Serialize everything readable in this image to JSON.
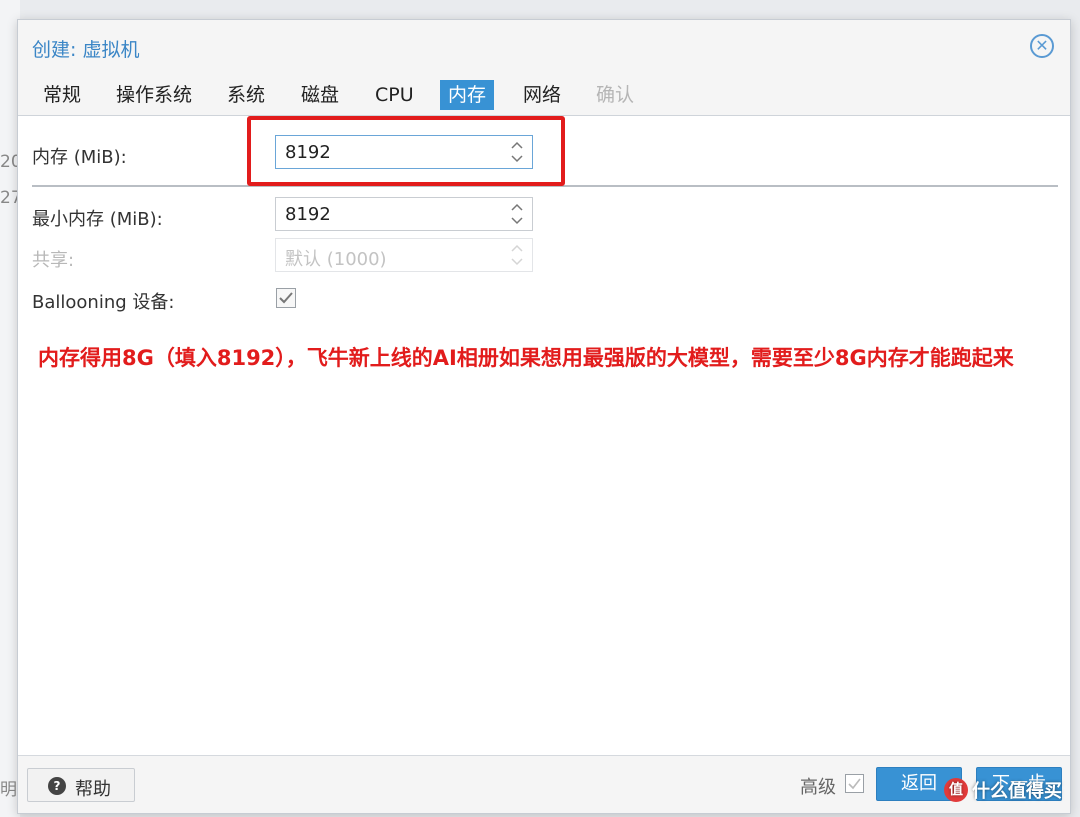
{
  "background": {
    "peek_1": "20",
    "peek_2": "27",
    "peek_3": "明"
  },
  "dialog": {
    "title": "创建: 虚拟机",
    "close_icon": "close-circle-icon"
  },
  "tabs": [
    {
      "label": "常规",
      "state": "normal"
    },
    {
      "label": "操作系统",
      "state": "normal"
    },
    {
      "label": "系统",
      "state": "normal"
    },
    {
      "label": "磁盘",
      "state": "normal"
    },
    {
      "label": "CPU",
      "state": "normal"
    },
    {
      "label": "内存",
      "state": "active"
    },
    {
      "label": "网络",
      "state": "normal"
    },
    {
      "label": "确认",
      "state": "disabled"
    }
  ],
  "form": {
    "memory": {
      "label": "内存 (MiB):",
      "value": "8192"
    },
    "min_memory": {
      "label": "最小内存 (MiB):",
      "value": "8192"
    },
    "shares": {
      "label": "共享:",
      "placeholder": "默认 (1000)"
    },
    "ballooning": {
      "label": "Ballooning 设备:",
      "checked": true
    }
  },
  "annotation": {
    "text": "内存得用8G（填入8192），飞牛新上线的AI相册如果想用最强版的大模型，需要至少8G内存才能跑起来",
    "color": "#e21c1c"
  },
  "footer": {
    "help_label": "帮助",
    "advanced_label": "高级",
    "advanced_checked": false,
    "back_label": "返回",
    "next_label": "下一步"
  },
  "watermark": {
    "text": "什么值得买",
    "icon": "值"
  },
  "colors": {
    "accent": "#3892d4",
    "title": "#3b86c6",
    "highlight": "#e21c1c"
  }
}
